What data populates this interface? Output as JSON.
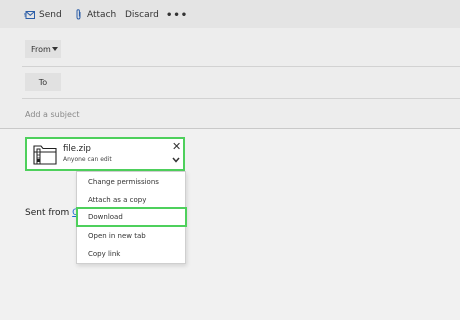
{
  "toolbar": {
    "send_label": "Send",
    "attach_label": "Attach",
    "discard_label": "Discard",
    "more_label": "•••",
    "send_icon": "send-icon",
    "attach_icon": "paperclip-icon"
  },
  "compose": {
    "from_label": "From",
    "to_label": "To",
    "subject_placeholder": "Add a subject",
    "sent_from_prefix": "Sent from",
    "sent_from_link": "O"
  },
  "attachment": {
    "file_name": "file.zip",
    "permission": "Anyone can edit",
    "icon": "zip-folder-icon",
    "highlight_color": "#4ed05c"
  },
  "context_menu": {
    "items": [
      "Change permissions",
      "Attach as a copy",
      "Download",
      "Open in new tab",
      "Copy link"
    ],
    "highlighted_item": "Download"
  }
}
